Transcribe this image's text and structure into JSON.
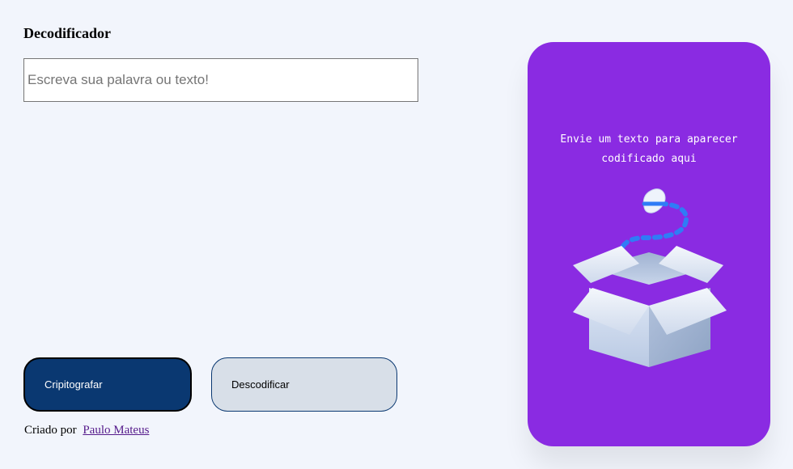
{
  "header": {
    "title": "Decodificador"
  },
  "input": {
    "placeholder": "Escreva sua palavra ou texto!",
    "value": ""
  },
  "buttons": {
    "encrypt_label": "Cripitografar",
    "decrypt_label": "Descodificar"
  },
  "footer": {
    "created_by_label": "Criado por",
    "author_link": "Paulo Mateus"
  },
  "output": {
    "message": "Envie um texto para aparecer codificado aqui",
    "illustration_icon": "open-box-icon"
  },
  "colors": {
    "background": "#f2f5fc",
    "panel": "#8a2be2",
    "primary_button": "#0a3871",
    "secondary_button": "#d8dfe8",
    "link": "#551a8b"
  }
}
